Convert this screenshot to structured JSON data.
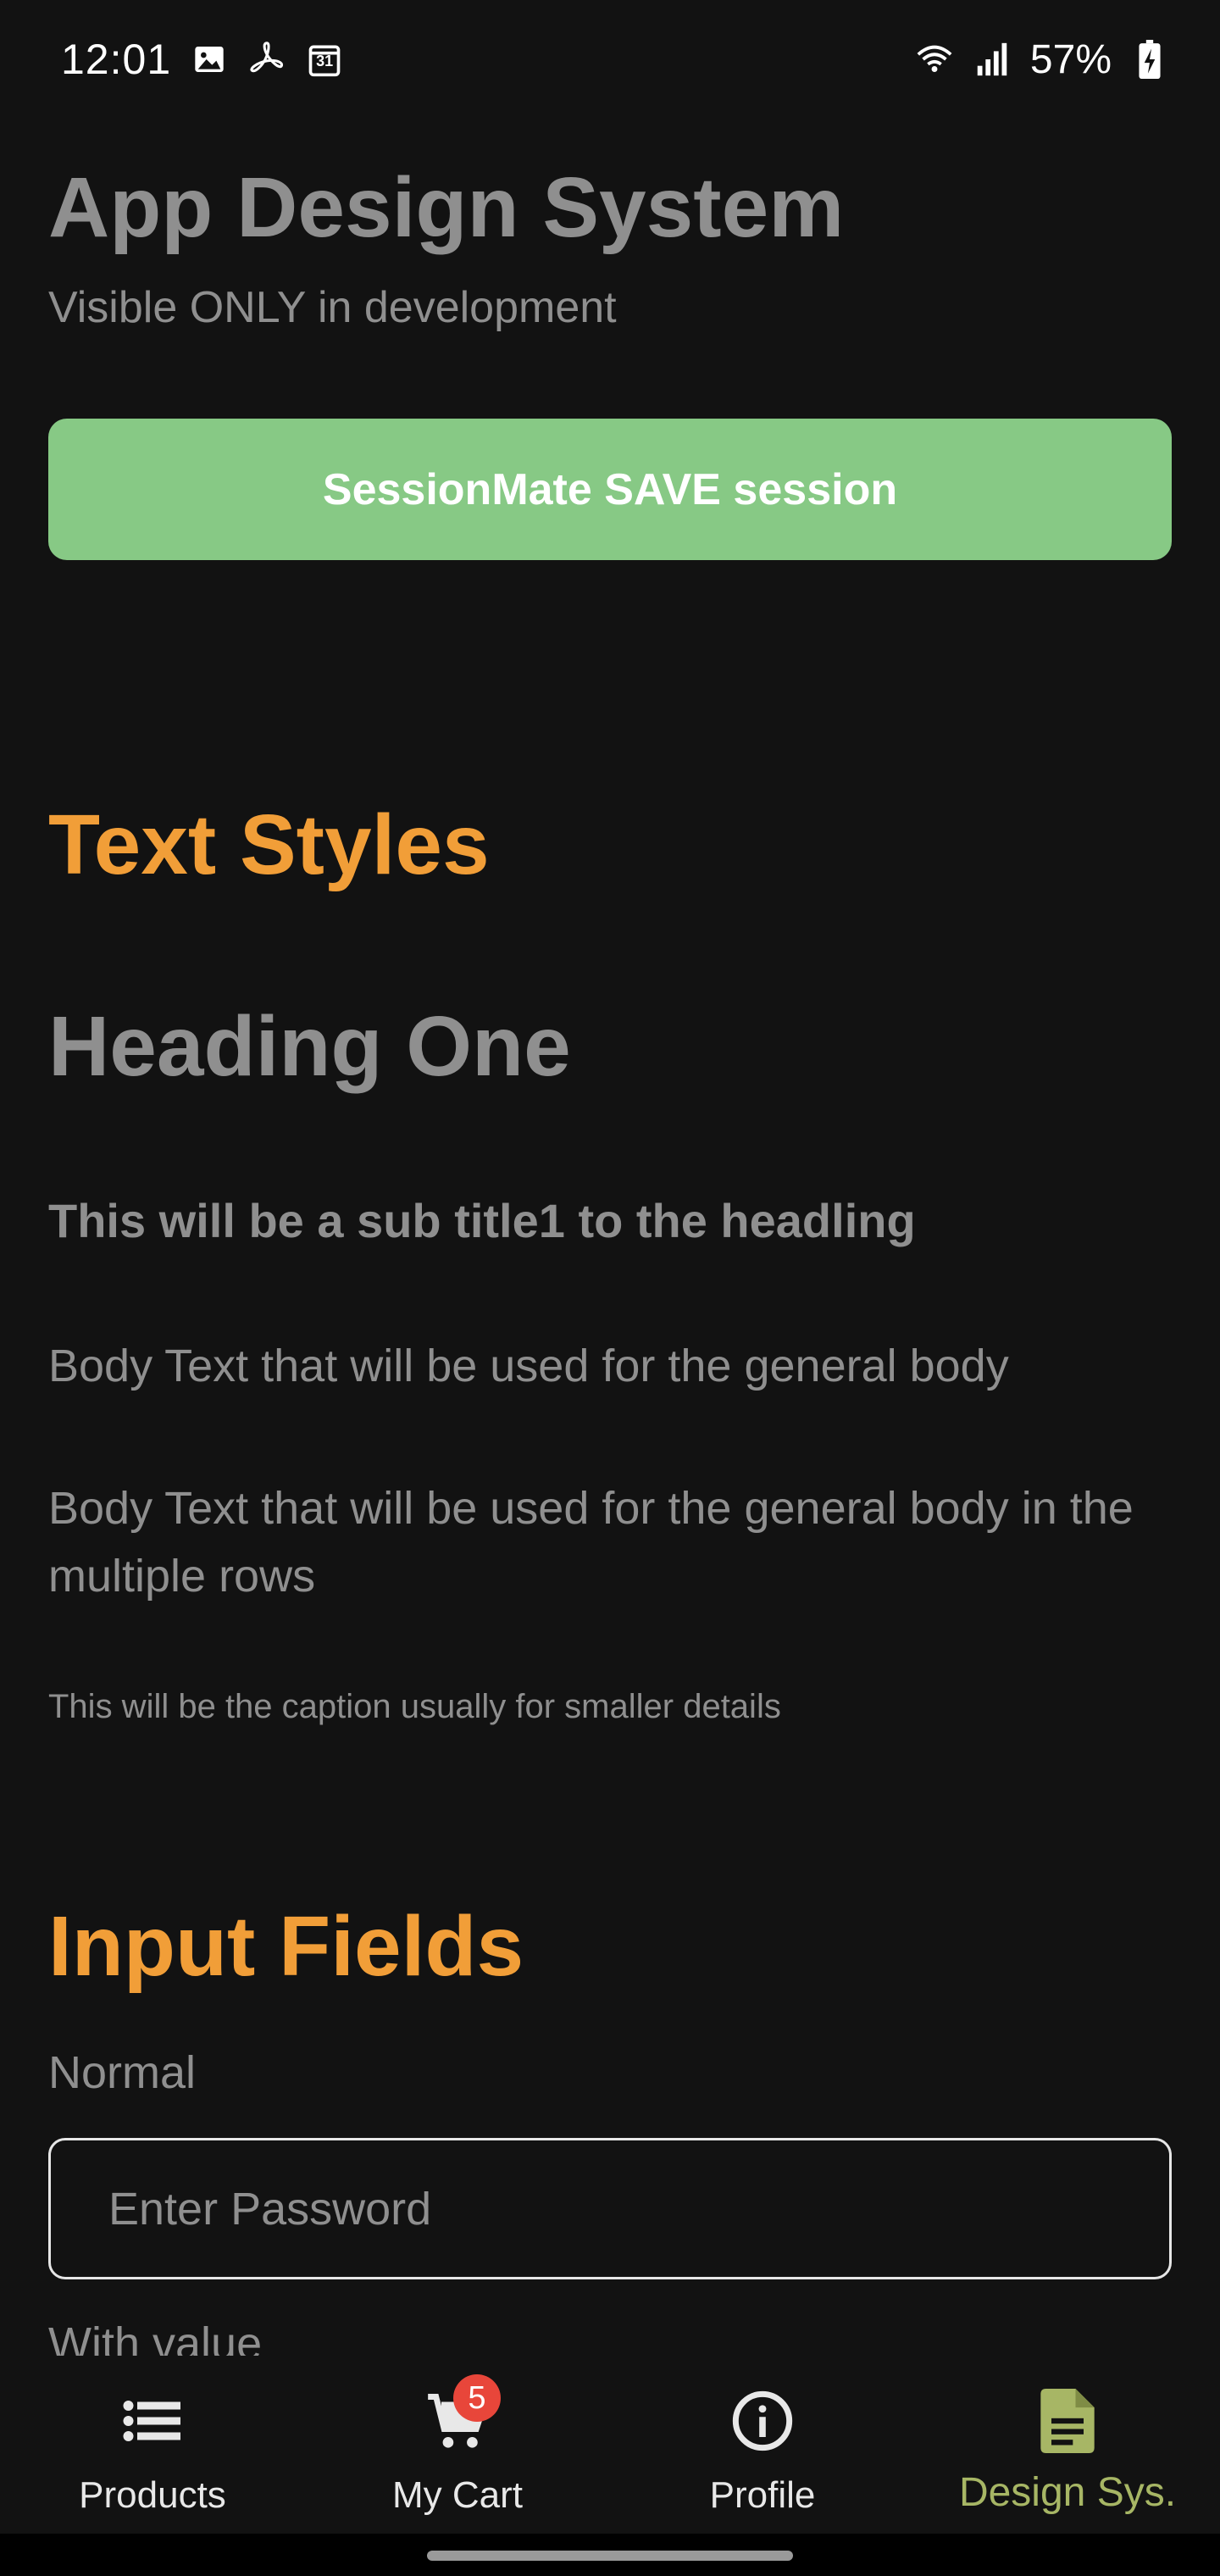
{
  "status_bar": {
    "time": "12:01",
    "battery": "57%",
    "notification_icons": [
      "image-icon",
      "pdf-icon",
      "calendar-icon"
    ],
    "calendar_day": "31",
    "system_icons": [
      "wifi-icon",
      "signal-icon",
      "battery-charging-icon"
    ]
  },
  "header": {
    "title": "App Design System",
    "subtitle": "Visible ONLY in development"
  },
  "save_button": {
    "label": "SessionMate SAVE session",
    "color": "#87c985"
  },
  "text_styles": {
    "section_title": "Text Styles",
    "heading_one": "Heading One",
    "subtitle1": "This will be a sub title1 to the headling",
    "body_single": "Body Text that will be used for the general body",
    "body_multi": "Body Text that will be used for the general body in the multiple rows",
    "caption": "This will be the caption usually for smaller details"
  },
  "input_fields": {
    "section_title": "Input Fields",
    "normal_label": "Normal",
    "password_placeholder": "Enter Password",
    "with_value_label": "With value"
  },
  "colors": {
    "section_accent": "#f19e38",
    "active_nav": "#a7b665",
    "badge": "#e8463a",
    "background": "#121212"
  },
  "bottom_nav": {
    "items": [
      {
        "label": "Products",
        "icon": "list-icon"
      },
      {
        "label": "My Cart",
        "icon": "cart-icon",
        "badge": "5"
      },
      {
        "label": "Profile",
        "icon": "info-icon"
      },
      {
        "label": "Design Sys.",
        "icon": "document-icon",
        "active": true
      }
    ]
  }
}
